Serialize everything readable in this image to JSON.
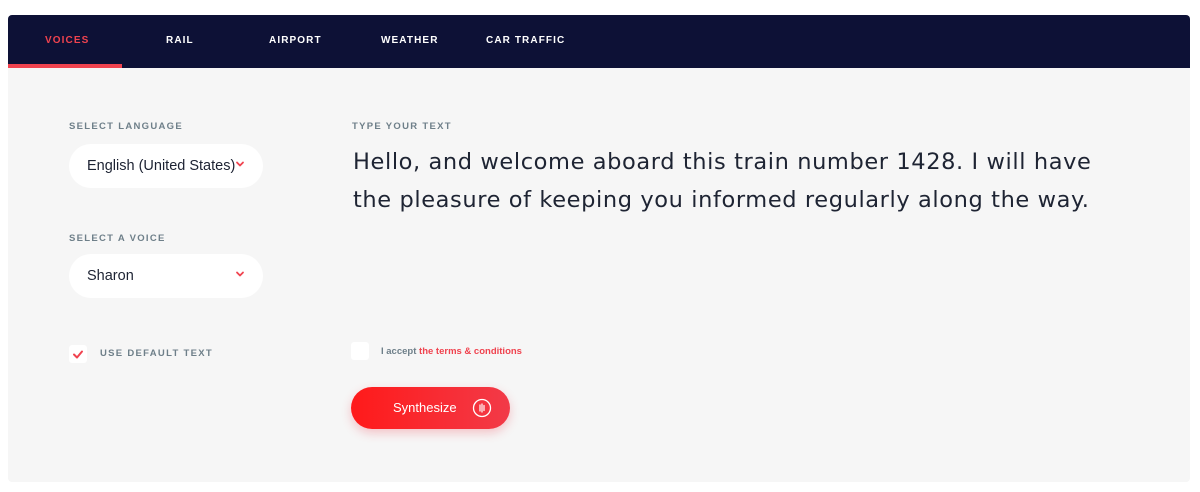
{
  "nav": {
    "tabs": [
      {
        "label": "VOICES",
        "active": true
      },
      {
        "label": "RAIL",
        "active": false
      },
      {
        "label": "AIRPORT",
        "active": false
      },
      {
        "label": "WEATHER",
        "active": false
      },
      {
        "label": "CAR TRAFFIC",
        "active": false
      }
    ]
  },
  "language": {
    "label": "SELECT LANGUAGE",
    "value": "English (United States)"
  },
  "voice": {
    "label": "SELECT A VOICE",
    "value": "Sharon"
  },
  "default_text": {
    "label": "USE DEFAULT TEXT",
    "checked": true
  },
  "text_input": {
    "label": "TYPE YOUR TEXT",
    "value": "Hello, and welcome aboard this train number 1428. I will have the pleasure of  keeping you informed regularly along the way."
  },
  "terms": {
    "prefix": "I accept ",
    "link": "the terms & conditions",
    "checked": false
  },
  "synthesize": {
    "label": "Synthesize"
  },
  "colors": {
    "nav_bg": "#0d1136",
    "accent": "#f0434f",
    "panel_bg": "#f6f6f6"
  }
}
